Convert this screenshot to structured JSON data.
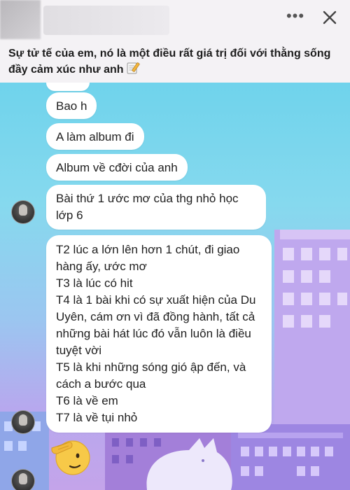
{
  "post": {
    "caption": "Sự tử tế của em, nó là một điều rất giá trị đối với thằng sống đầy cảm xúc như anh",
    "caption_icon": "memo-pencil-icon",
    "more_icon": "more-horizontal-icon",
    "close_icon": "close-icon"
  },
  "chat": {
    "messages": [
      {
        "text": "Bao h"
      },
      {
        "text": "A làm album đi"
      },
      {
        "text": "Album về cđời của anh"
      },
      {
        "text": "Bài thứ 1 ước mơ của thg nhỏ học lớp 6"
      },
      {
        "lines": [
          "T2 lúc a lớn lên hơn 1 chút, đi giao",
          "hàng ấy, ước mơ",
          "T3 là lúc có hit",
          "T4 là 1 bài khi có sự xuất hiện của Du",
          "Uyên, cám ơn vì đã đồng hành, tất cả",
          "những bài hát lúc đó vẫn luôn là điều",
          "tuyệt vời",
          "T5 là khi những sóng gió ập đến, và",
          "cách a bước qua",
          "T6 là về em",
          "T7 là về tụi nhỏ"
        ]
      }
    ],
    "reaction_emoji": "saluting-face-emoji",
    "colors": {
      "bubble": "#ffffff",
      "sky_top": "#6fd3ec",
      "sky_bottom": "#c4a4ea"
    }
  }
}
